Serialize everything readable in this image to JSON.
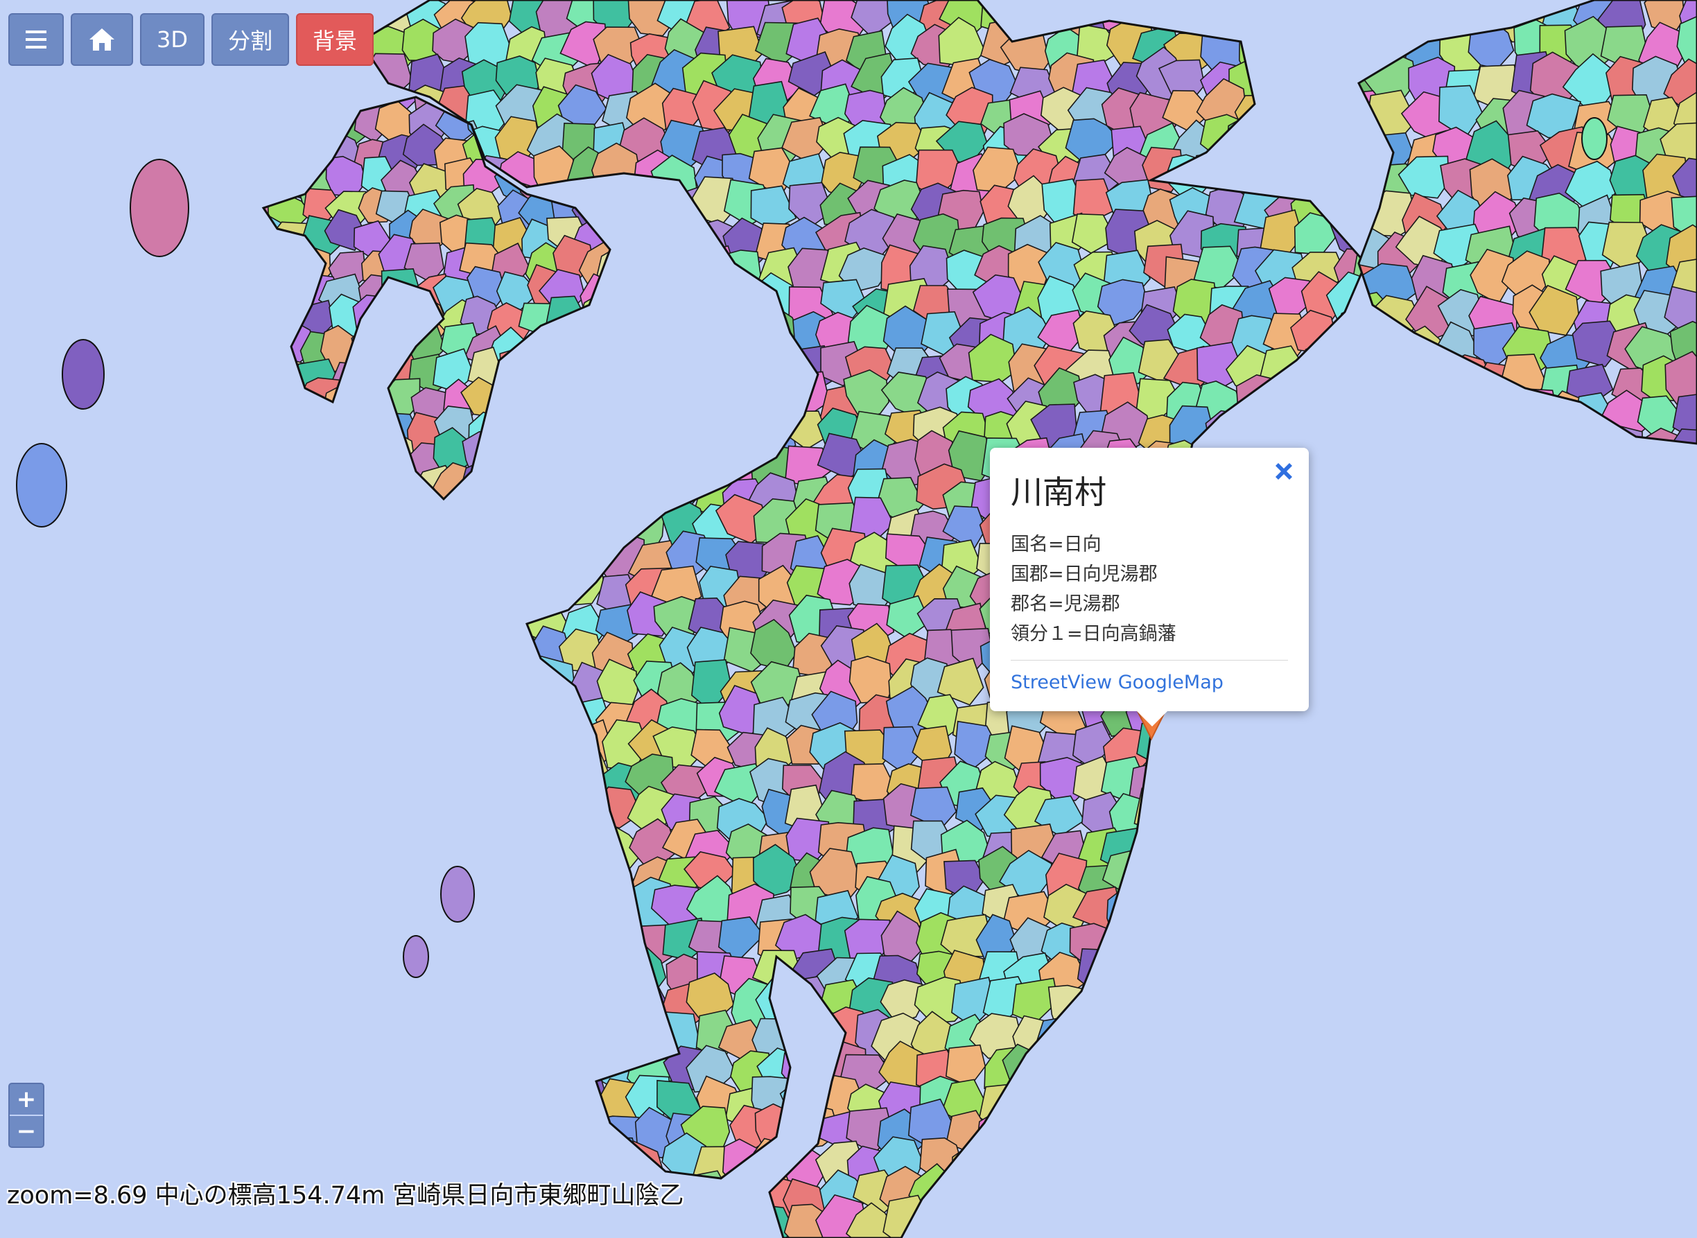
{
  "toolbar": {
    "menu_icon": "hamburger-icon",
    "home_icon": "home-icon",
    "three_d_label": "3D",
    "split_label": "分割",
    "background_label": "背景"
  },
  "popup": {
    "title": "川南村",
    "lines": [
      "国名=日向",
      "国郡=日向児湯郡",
      "郡名=児湯郡",
      "領分１=日向高鍋藩"
    ],
    "link_label": "StreetView GoogleMap",
    "close_icon": "close-x-icon"
  },
  "zoom": {
    "in_label": "+",
    "out_label": "−"
  },
  "status": {
    "text": "zoom=8.69 中心の標高154.74m 宮崎県日向市東郷町山陰乙"
  },
  "colors": {
    "sea": "#c3d3f7",
    "button": "#6f8bc4",
    "button_background_active": "#e25a5a",
    "link": "#3273dc",
    "close_icon": "#2f6fe0",
    "marker": "#f07a3a"
  }
}
